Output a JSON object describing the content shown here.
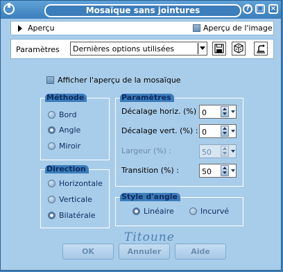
{
  "window": {
    "title": "Mosaïque sans jointures"
  },
  "titlebar": {
    "help_glyph": "?",
    "restore_glyph": "□",
    "close_glyph": "×"
  },
  "preview": {
    "label": "Aperçu",
    "image_preview_label": "Aperçu de l'image",
    "image_preview_checked": false
  },
  "parameters_bar": {
    "label": "Paramètres",
    "preset_value": "Dernières options utilisées"
  },
  "tile_preview": {
    "label": "Afficher l'aperçu de la mosaïque",
    "checked": false
  },
  "method_group": {
    "title": "Méthode",
    "options": [
      "Bord",
      "Angle",
      "Miroir"
    ],
    "selected": "Angle"
  },
  "direction_group": {
    "title": "Direction",
    "options": [
      "Horizontale",
      "Verticale",
      "Bilatérale"
    ],
    "selected": "Bilatérale"
  },
  "params_group": {
    "title": "Paramètres",
    "horizontal_offset_label": "Décalage horiz. (%) :",
    "horizontal_offset_value": "0",
    "vertical_offset_label": "Décalage vert. (%) :",
    "vertical_offset_value": "0",
    "width_label": "Largeur (%) :",
    "width_value": "50",
    "transition_label": "Transition (%) :",
    "transition_value": "50"
  },
  "corner_style_group": {
    "title": "Style d'angle",
    "options": [
      "Linéaire",
      "Incurvé"
    ],
    "selected": "Linéaire"
  },
  "watermark": "Titoune",
  "buttons": {
    "ok": "OK",
    "cancel": "Annuler",
    "help": "Aide"
  },
  "colors": {
    "window_bg": "#a8cdea",
    "titlebar": "#3c7dbb",
    "group_label_text": "#0d2a5e"
  }
}
